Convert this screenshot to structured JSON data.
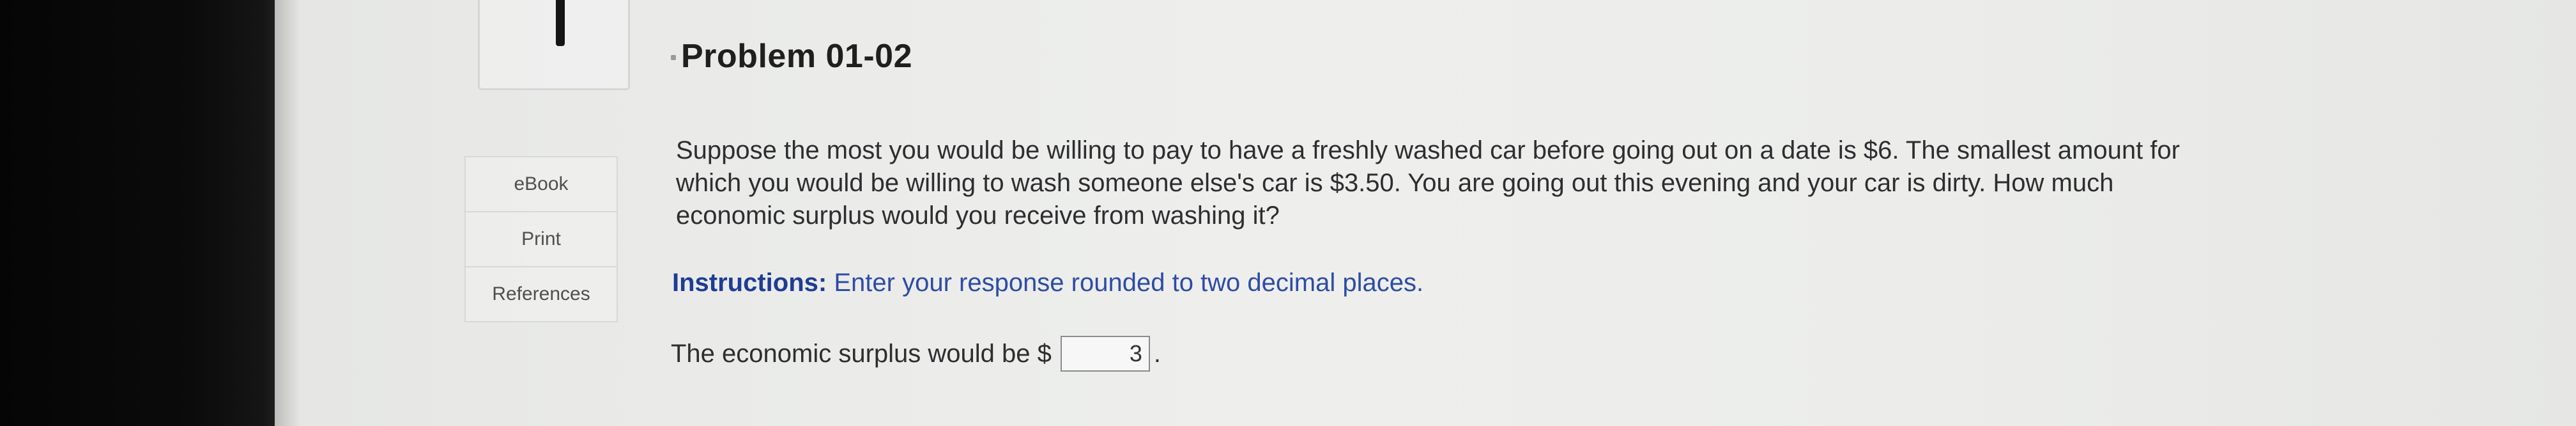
{
  "problem": {
    "title": "Problem 01-02",
    "text_line_1": "Suppose the most you would be willing to pay to have a freshly washed car before going out on a date is $6. The smallest amount for",
    "text_line_2": "which you would be willing to wash someone else's car is $3.50. You are going out this evening and your car is dirty. How much",
    "text_line_3": "economic surplus would you receive from washing it?"
  },
  "instructions": {
    "label": "Instructions:",
    "text": "Enter your response rounded to two decimal places."
  },
  "answer": {
    "prefix": "The economic surplus would be $",
    "value": "3",
    "suffix": "."
  },
  "side_menu": {
    "items": [
      {
        "label": "eBook"
      },
      {
        "label": "Print"
      },
      {
        "label": "References"
      }
    ]
  },
  "colors": {
    "instructions_label": "#1e3c96",
    "instructions_text": "#2d4ba8",
    "body_text": "#2e2e30",
    "bezel": "#0b0b0b"
  }
}
